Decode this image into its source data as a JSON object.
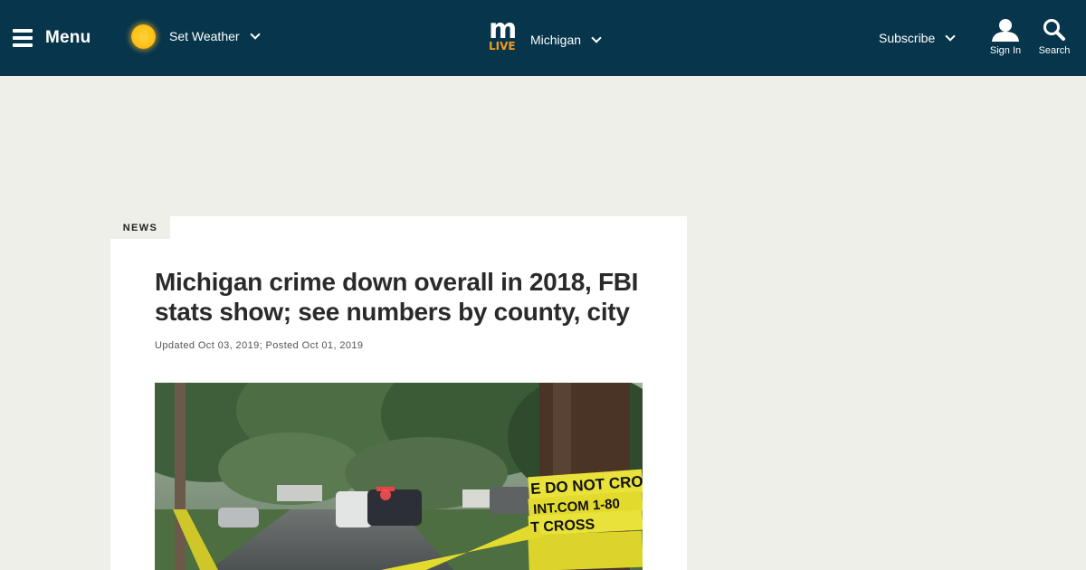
{
  "header": {
    "menu_label": "Menu",
    "weather_label": "Set Weather",
    "logo_letter": "m",
    "logo_sub": "LIVE",
    "region_label": "Michigan",
    "subscribe_label": "Subscribe",
    "signin_label": "Sign In",
    "search_label": "Search"
  },
  "article": {
    "section": "NEWS",
    "headline": "Michigan crime down overall in 2018, FBI stats show; see numbers by county, city",
    "dateline": "Updated Oct 03, 2019; Posted Oct 01, 2019",
    "photo": {
      "tape_line1": "E DO NOT CROSS",
      "tape_line2": "INT.COM 1-80",
      "tape_line3": "T CROSS"
    }
  },
  "colors": {
    "header_bg": "#07354c",
    "page_bg": "#efefea",
    "logo_accent": "#f39c1b",
    "tape_yellow": "#e9e23a"
  },
  "icons": [
    "hamburger-icon",
    "sun-icon",
    "chevron-down-icon",
    "user-icon",
    "search-icon"
  ]
}
